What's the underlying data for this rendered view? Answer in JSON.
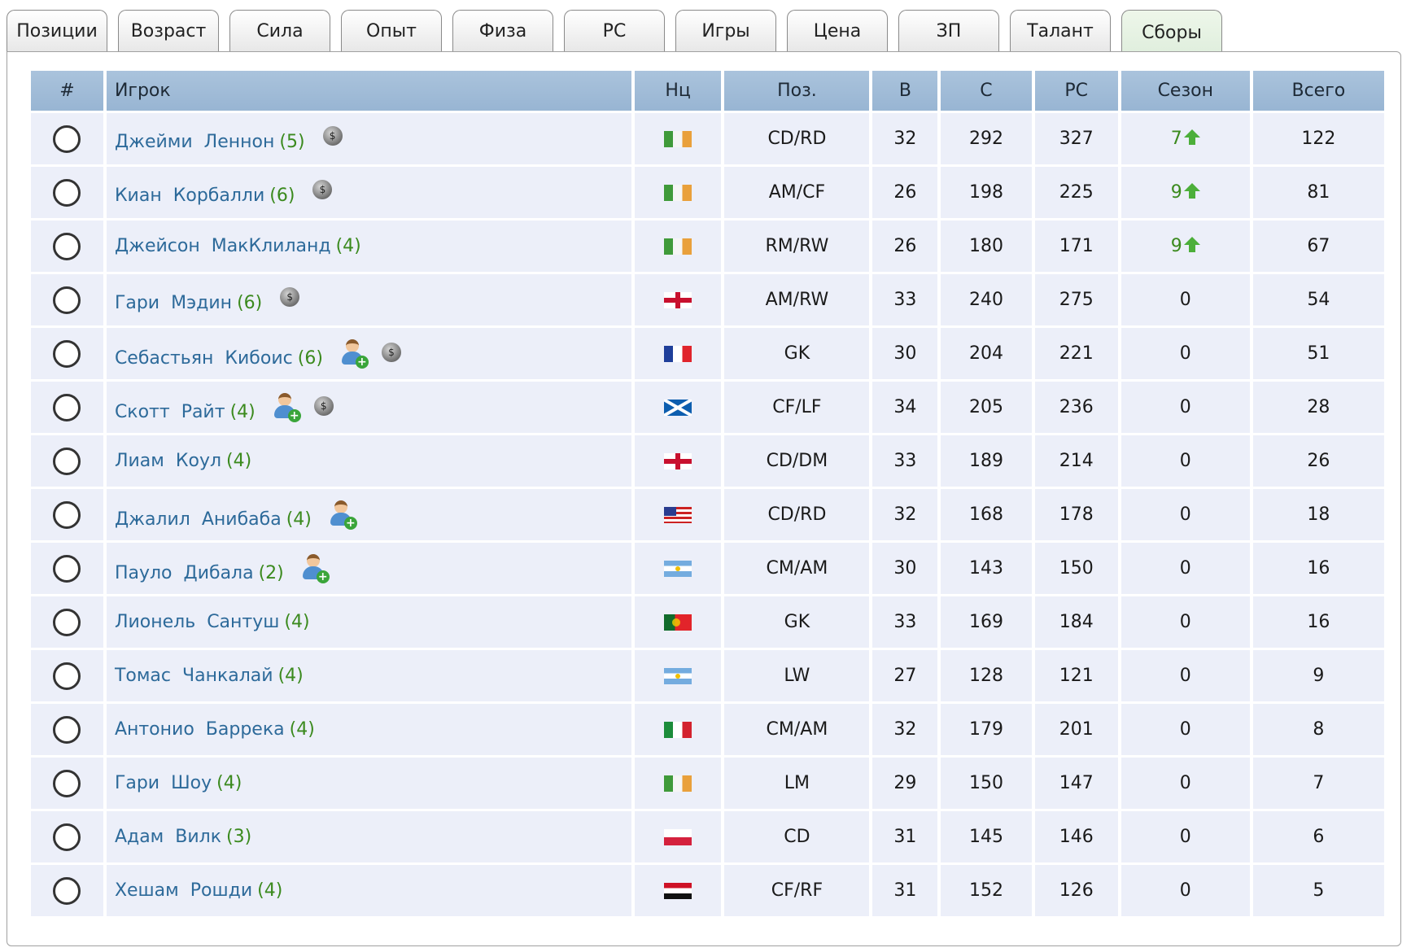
{
  "tabs": [
    "Позиции",
    "Возраст",
    "Сила",
    "Опыт",
    "Физа",
    "РС",
    "Игры",
    "Цена",
    "ЗП",
    "Талант",
    "Сборы"
  ],
  "active_tab": "Сборы",
  "table": {
    "headers": [
      "#",
      "Игрок",
      "Нц",
      "Поз.",
      "В",
      "С",
      "РС",
      "Сезон",
      "Всего"
    ],
    "rows": [
      {
        "first": "Джейми",
        "last": "Леннон",
        "talent": "(5)",
        "coin": true,
        "person": false,
        "flag": "ie",
        "pos": "CD/RD",
        "age": "32",
        "str": "292",
        "rs": "327",
        "season": "7",
        "up": true,
        "total": "122"
      },
      {
        "first": "Киан",
        "last": "Корбалли",
        "talent": "(6)",
        "coin": true,
        "person": false,
        "flag": "ie",
        "pos": "AM/CF",
        "age": "26",
        "str": "198",
        "rs": "225",
        "season": "9",
        "up": true,
        "total": "81"
      },
      {
        "first": "Джейсон",
        "last": "МакКлиланд",
        "talent": "(4)",
        "coin": false,
        "person": false,
        "flag": "ie",
        "pos": "RM/RW",
        "age": "26",
        "str": "180",
        "rs": "171",
        "season": "9",
        "up": true,
        "total": "67"
      },
      {
        "first": "Гари",
        "last": "Мэдин",
        "talent": "(6)",
        "coin": true,
        "person": false,
        "flag": "eng",
        "pos": "AM/RW",
        "age": "33",
        "str": "240",
        "rs": "275",
        "season": "0",
        "up": false,
        "total": "54"
      },
      {
        "first": "Себастьян",
        "last": "Кибоис",
        "talent": "(6)",
        "coin": true,
        "person": true,
        "flag": "fr",
        "pos": "GK",
        "age": "30",
        "str": "204",
        "rs": "221",
        "season": "0",
        "up": false,
        "total": "51"
      },
      {
        "first": "Скотт",
        "last": "Райт",
        "talent": "(4)",
        "coin": true,
        "person": true,
        "flag": "sco",
        "pos": "CF/LF",
        "age": "34",
        "str": "205",
        "rs": "236",
        "season": "0",
        "up": false,
        "total": "28"
      },
      {
        "first": "Лиам",
        "last": "Коул",
        "talent": "(4)",
        "coin": false,
        "person": false,
        "flag": "eng",
        "pos": "CD/DM",
        "age": "33",
        "str": "189",
        "rs": "214",
        "season": "0",
        "up": false,
        "total": "26"
      },
      {
        "first": "Джалил",
        "last": "Анибаба",
        "talent": "(4)",
        "coin": false,
        "person": true,
        "flag": "us",
        "pos": "CD/RD",
        "age": "32",
        "str": "168",
        "rs": "178",
        "season": "0",
        "up": false,
        "total": "18"
      },
      {
        "first": "Пауло",
        "last": "Дибала",
        "talent": "(2)",
        "coin": false,
        "person": true,
        "flag": "ar",
        "pos": "CM/AM",
        "age": "30",
        "str": "143",
        "rs": "150",
        "season": "0",
        "up": false,
        "total": "16"
      },
      {
        "first": "Лионель",
        "last": "Сантуш",
        "talent": "(4)",
        "coin": false,
        "person": false,
        "flag": "pt",
        "pos": "GK",
        "age": "33",
        "str": "169",
        "rs": "184",
        "season": "0",
        "up": false,
        "total": "16"
      },
      {
        "first": "Томас",
        "last": "Чанкалай",
        "talent": "(4)",
        "coin": false,
        "person": false,
        "flag": "ar",
        "pos": "LW",
        "age": "27",
        "str": "128",
        "rs": "121",
        "season": "0",
        "up": false,
        "total": "9"
      },
      {
        "first": "Антонио",
        "last": "Баррека",
        "talent": "(4)",
        "coin": false,
        "person": false,
        "flag": "it",
        "pos": "CM/AM",
        "age": "32",
        "str": "179",
        "rs": "201",
        "season": "0",
        "up": false,
        "total": "8"
      },
      {
        "first": "Гари",
        "last": "Шоу",
        "talent": "(4)",
        "coin": false,
        "person": false,
        "flag": "ie",
        "pos": "LM",
        "age": "29",
        "str": "150",
        "rs": "147",
        "season": "0",
        "up": false,
        "total": "7"
      },
      {
        "first": "Адам",
        "last": "Вилк",
        "talent": "(3)",
        "coin": false,
        "person": false,
        "flag": "pl",
        "pos": "CD",
        "age": "31",
        "str": "145",
        "rs": "146",
        "season": "0",
        "up": false,
        "total": "6"
      },
      {
        "first": "Хешам",
        "last": "Рошди",
        "talent": "(4)",
        "coin": false,
        "person": false,
        "flag": "eg",
        "pos": "CF/RF",
        "age": "31",
        "str": "152",
        "rs": "126",
        "season": "0",
        "up": false,
        "total": "5"
      }
    ]
  }
}
